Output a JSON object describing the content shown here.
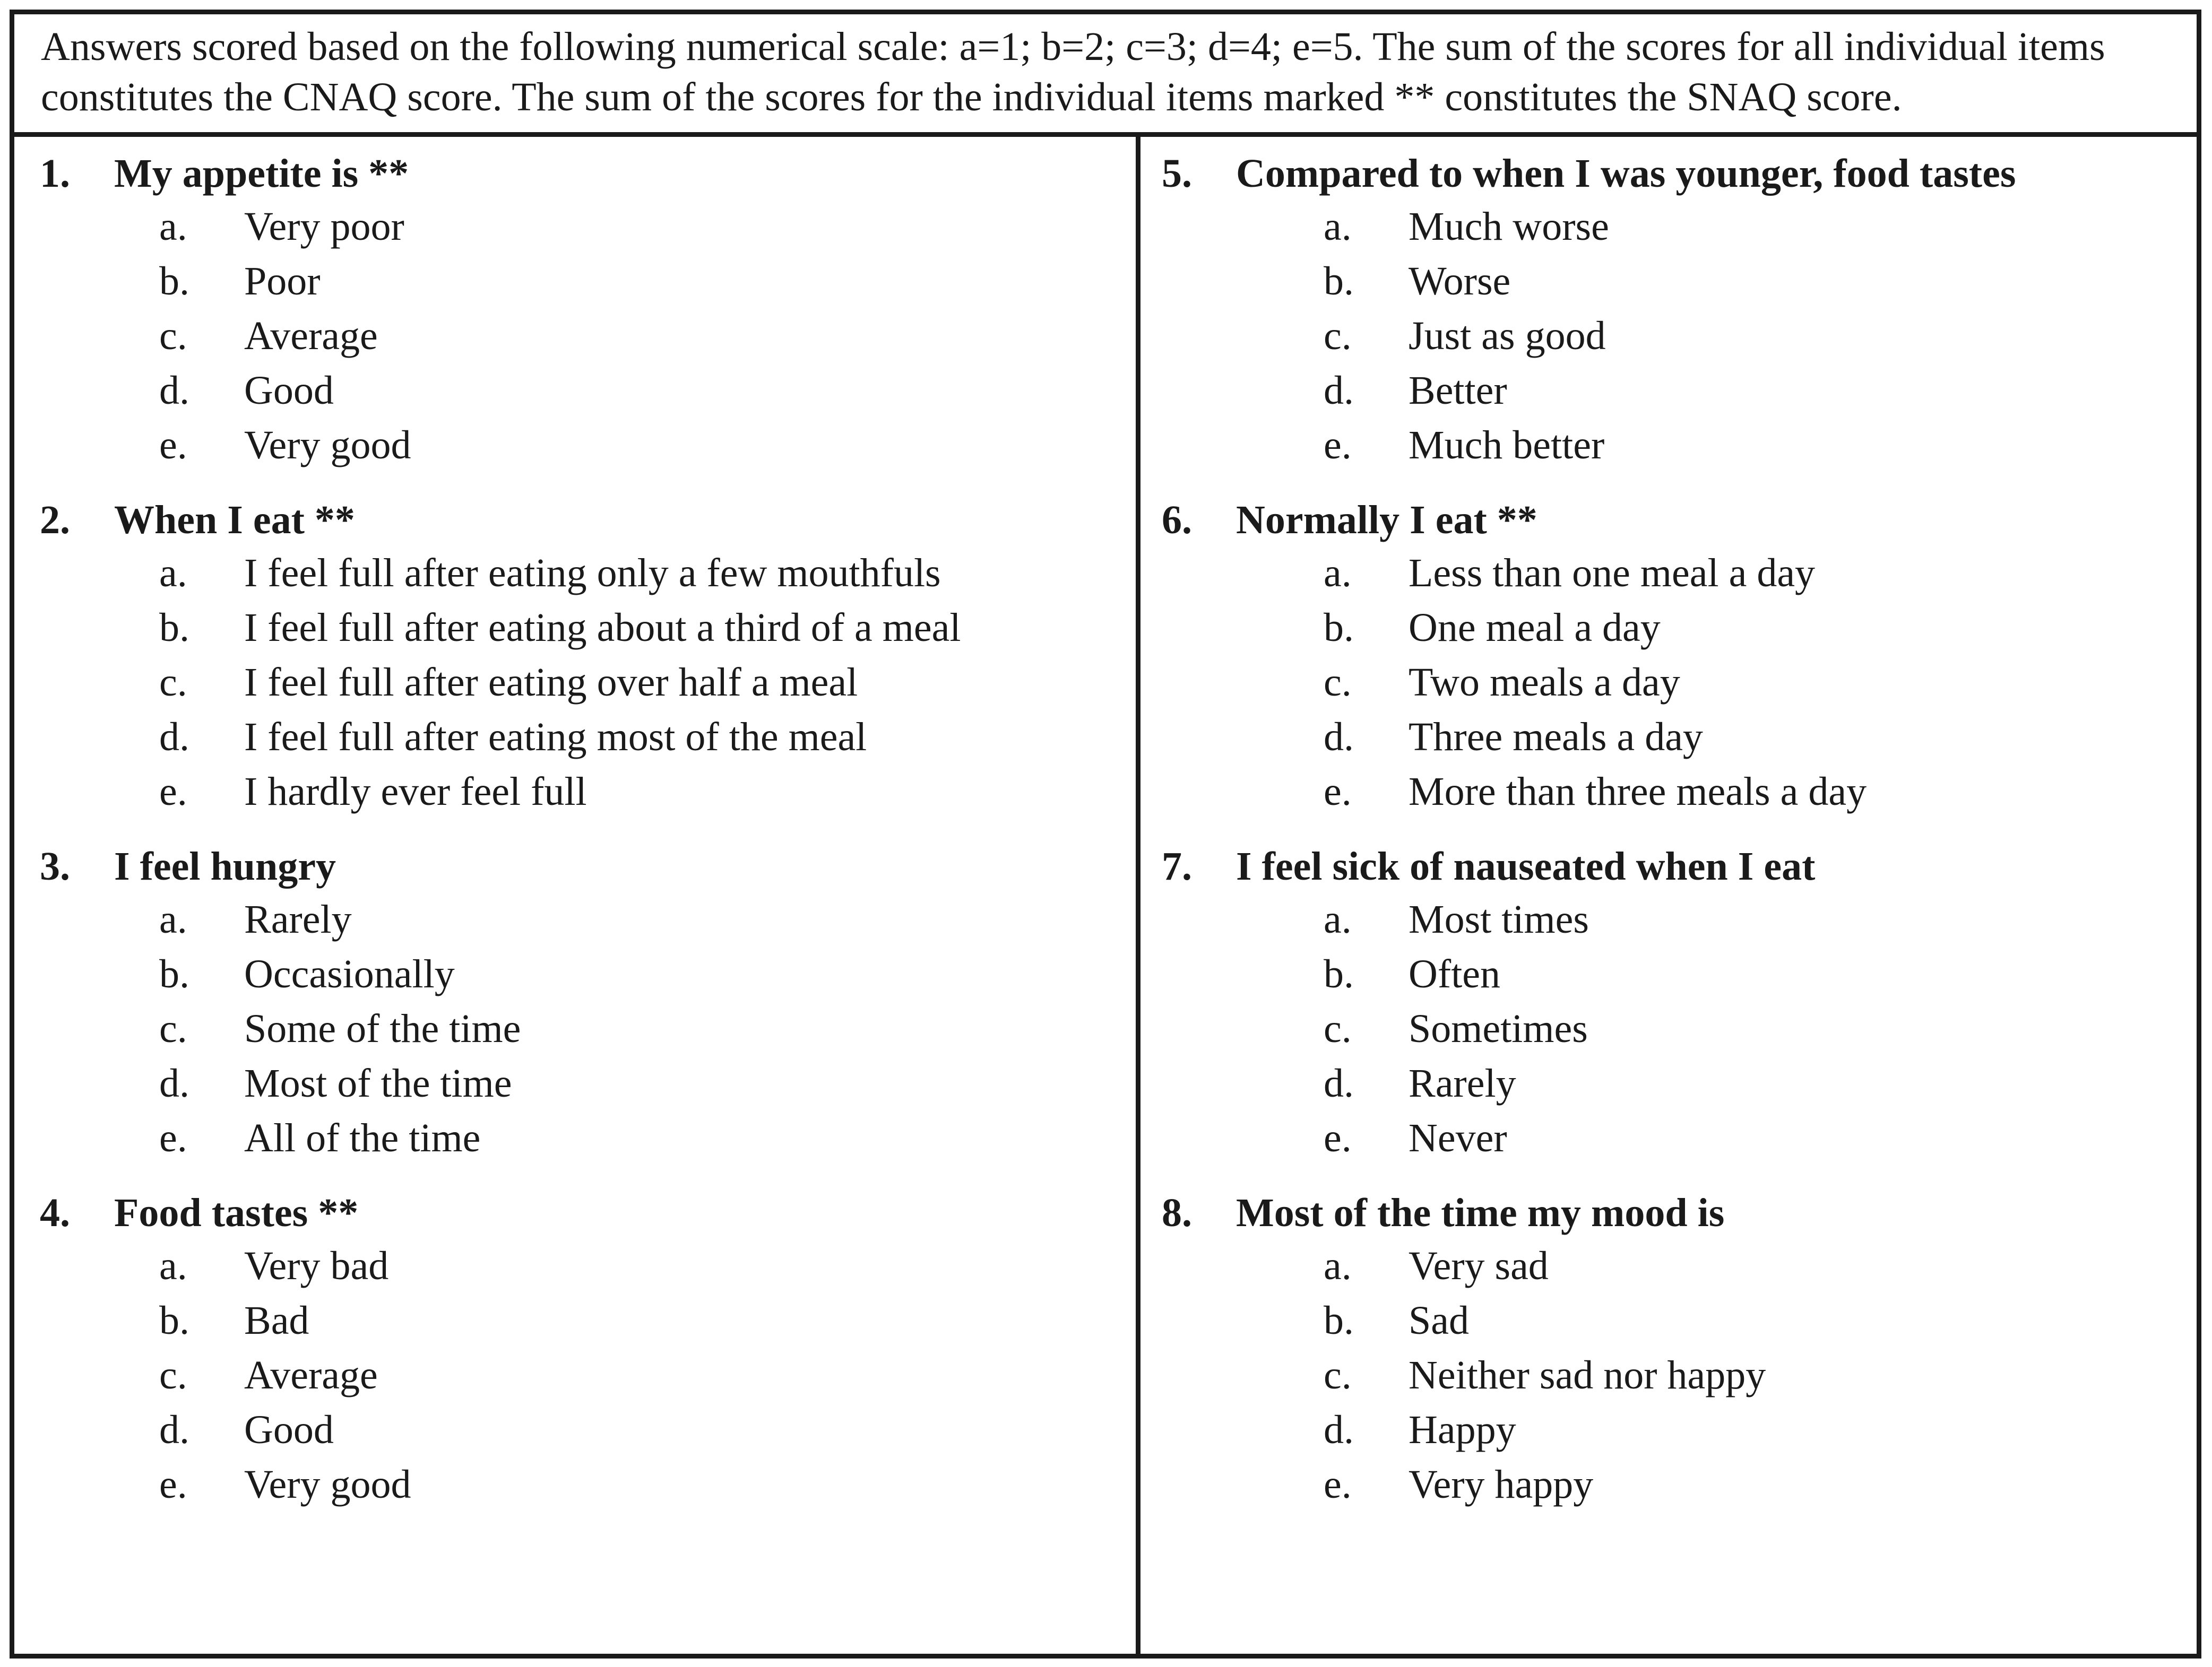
{
  "document": {
    "scoring_instructions": "Answers scored based on the following numerical scale: a=1; b=2; c=3; d=4; e=5. The sum of the scores for all individual items constitutes the CNAQ score. The sum of the scores for the individual items marked ** constitutes the SNAQ score.",
    "scale": {
      "a": 1,
      "b": 2,
      "c": 3,
      "d": 4,
      "e": 5
    },
    "snaq_marker": "**",
    "border_color": "#1a1a1a",
    "background_color": "#ffffff"
  },
  "left_column": {
    "questions": [
      {
        "number": "1.",
        "text": "My appetite is **",
        "answers": [
          {
            "letter": "a.",
            "text": "Very poor"
          },
          {
            "letter": "b.",
            "text": "Poor"
          },
          {
            "letter": "c.",
            "text": "Average"
          },
          {
            "letter": "d.",
            "text": "Good"
          },
          {
            "letter": "e.",
            "text": "Very good"
          }
        ]
      },
      {
        "number": "2.",
        "text": "When I eat **",
        "answers": [
          {
            "letter": "a.",
            "text": "I feel full after eating only a few mouthfuls"
          },
          {
            "letter": "b.",
            "text": "I feel full after eating about a third of a meal"
          },
          {
            "letter": "c.",
            "text": "I feel full after eating over half a meal"
          },
          {
            "letter": "d.",
            "text": "I feel full after eating most of the meal"
          },
          {
            "letter": "e.",
            "text": "I hardly ever feel full"
          }
        ]
      },
      {
        "number": "3.",
        "text": "I feel hungry",
        "answers": [
          {
            "letter": "a.",
            "text": "Rarely"
          },
          {
            "letter": "b.",
            "text": "Occasionally"
          },
          {
            "letter": "c.",
            "text": "Some of the time"
          },
          {
            "letter": "d.",
            "text": "Most of the time"
          },
          {
            "letter": "e.",
            "text": "All of the time"
          }
        ]
      },
      {
        "number": "4.",
        "text": "Food tastes **",
        "answers": [
          {
            "letter": "a.",
            "text": "Very bad"
          },
          {
            "letter": "b.",
            "text": "Bad"
          },
          {
            "letter": "c.",
            "text": "Average"
          },
          {
            "letter": "d.",
            "text": "Good"
          },
          {
            "letter": "e.",
            "text": "Very good"
          }
        ]
      }
    ]
  },
  "right_column": {
    "questions": [
      {
        "number": "5.",
        "text": "Compared to when I was younger, food tastes",
        "answers": [
          {
            "letter": "a.",
            "text": "Much worse"
          },
          {
            "letter": "b.",
            "text": "Worse"
          },
          {
            "letter": "c.",
            "text": "Just as good"
          },
          {
            "letter": "d.",
            "text": "Better"
          },
          {
            "letter": "e.",
            "text": "Much better"
          }
        ]
      },
      {
        "number": "6.",
        "text": "Normally I eat **",
        "answers": [
          {
            "letter": "a.",
            "text": "Less than one meal a day"
          },
          {
            "letter": "b.",
            "text": "One meal a day"
          },
          {
            "letter": "c.",
            "text": "Two meals a day"
          },
          {
            "letter": "d.",
            "text": "Three meals a day"
          },
          {
            "letter": "e.",
            "text": "More than three meals a day"
          }
        ]
      },
      {
        "number": "7.",
        "text": "I feel sick of nauseated when I eat",
        "answers": [
          {
            "letter": "a.",
            "text": "Most times"
          },
          {
            "letter": "b.",
            "text": "Often"
          },
          {
            "letter": "c.",
            "text": "Sometimes"
          },
          {
            "letter": "d.",
            "text": "Rarely"
          },
          {
            "letter": "e.",
            "text": "Never"
          }
        ]
      },
      {
        "number": "8.",
        "text": "Most of the time my mood is",
        "answers": [
          {
            "letter": "a.",
            "text": "Very sad"
          },
          {
            "letter": "b.",
            "text": "Sad"
          },
          {
            "letter": "c.",
            "text": "Neither sad nor happy"
          },
          {
            "letter": "d.",
            "text": "Happy"
          },
          {
            "letter": "e.",
            "text": "Very happy"
          }
        ]
      }
    ]
  }
}
